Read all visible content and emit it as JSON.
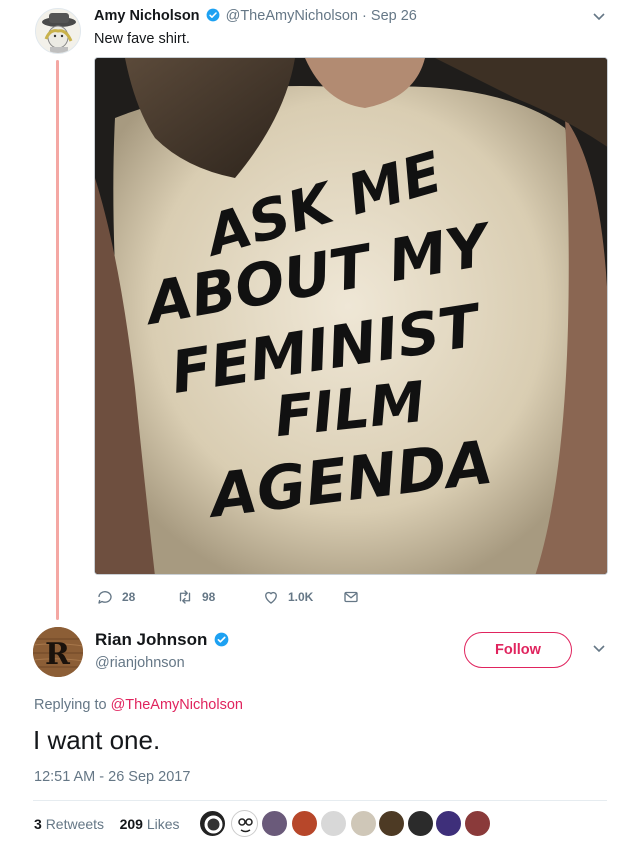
{
  "tweet1": {
    "name": "Amy Nicholson",
    "handle": "@TheAmyNicholson",
    "separator": "·",
    "date": "Sep 26",
    "text": "New fave shirt.",
    "shirt_lines": [
      "ASK ME",
      "ABOUT MY",
      "FEMINIST",
      "FILM",
      "AGENDA"
    ],
    "actions": {
      "replies": "28",
      "retweets": "98",
      "likes": "1.0K"
    }
  },
  "tweet2": {
    "name": "Rian Johnson",
    "handle": "@rianjohnson",
    "avatar_letter": "R",
    "follow_label": "Follow",
    "replying_prefix": "Replying to",
    "replying_to": "@TheAmyNicholson",
    "text": "I want one.",
    "timestamp": "12:51 AM - 26 Sep 2017",
    "retweets_count": "3",
    "retweets_label": "Retweets",
    "likes_count": "209",
    "likes_label": "Likes"
  },
  "colors": {
    "accent": "#e0245e",
    "verified": "#1da1f2",
    "thread_line": "#f4a7a3",
    "muted": "#657786"
  }
}
